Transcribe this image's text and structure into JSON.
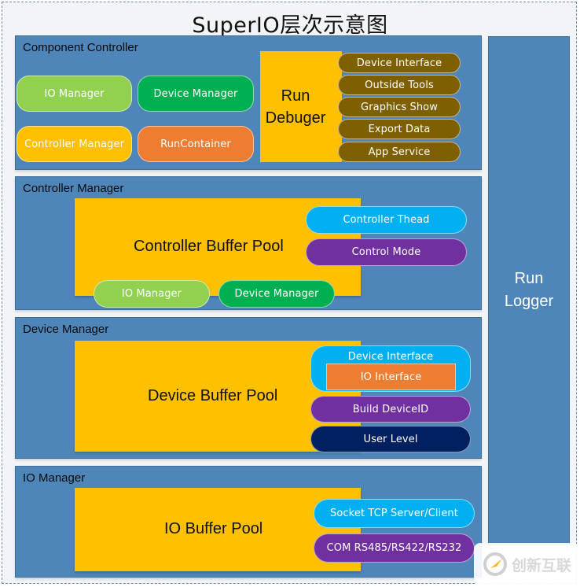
{
  "title": "SuperIO层次示意图",
  "component_controller": {
    "title": "Component Controller",
    "modules": [
      "IO Manager",
      "Device Manager",
      "Controller Manager",
      "RunContainer"
    ],
    "debuger_line1": "Run",
    "debuger_line2": "Debuger",
    "debuger_items": [
      "Device Interface",
      "Outside Tools",
      "Graphics Show",
      "Export Data",
      "App Service"
    ]
  },
  "controller_manager": {
    "title": "Controller Manager",
    "pool": "Controller Buffer Pool",
    "items": [
      "Controller Thead",
      "Control Mode"
    ],
    "bottom_items": [
      "IO Manager",
      "Device Manager"
    ]
  },
  "device_manager": {
    "title": "Device Manager",
    "pool": "Device Buffer Pool",
    "device_interface": "Device Interface",
    "io_interface": "IO Interface",
    "items": [
      "Build DeviceID",
      "User Level"
    ]
  },
  "io_manager": {
    "title": "IO Manager",
    "pool": "IO Buffer Pool",
    "items": [
      "Socket TCP Server/Client",
      "COM RS485/RS422/RS232"
    ]
  },
  "run_logger": {
    "line1": "Run",
    "line2": "Logger"
  },
  "watermark": {
    "text": "创新互联"
  },
  "colors": {
    "panel": "#4f86ba",
    "pool": "#ffc000",
    "light_green": "#92d050",
    "dark_green": "#00b050",
    "orange": "#ed7d31",
    "olive": "#7f6000",
    "cyan": "#00b0f0",
    "purple": "#7030a0",
    "navy": "#002060"
  }
}
